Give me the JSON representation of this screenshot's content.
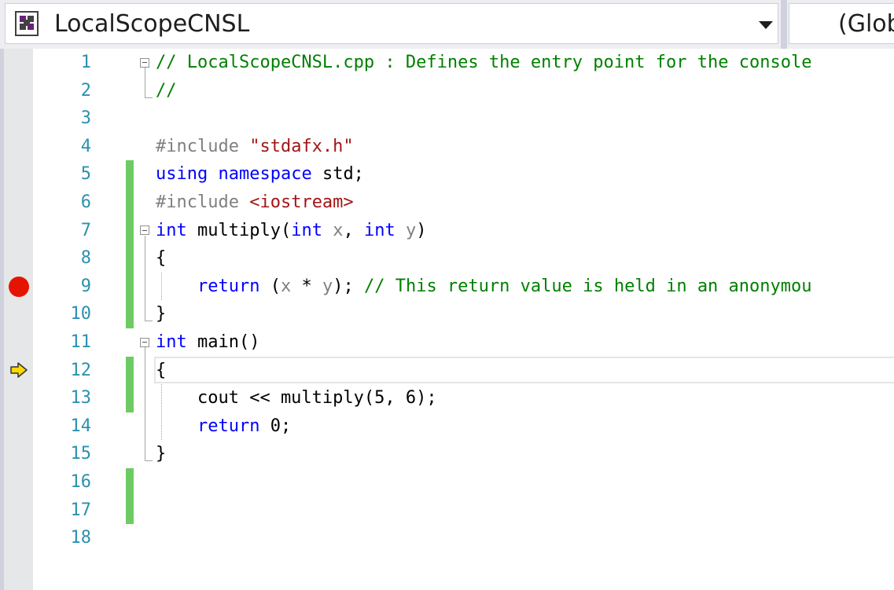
{
  "navbar": {
    "project_name": "LocalScopeCNSL",
    "scope_name": "(Global Scope)"
  },
  "icons": {
    "project": "cpp-project-icon",
    "dropdown": "chevron-down-icon",
    "breakpoint": "breakpoint-icon",
    "instruction_pointer": "instruction-pointer-arrow-icon"
  },
  "colors": {
    "keyword": "#0000ff",
    "comment": "#008000",
    "preprocessor": "#808080",
    "string": "#a31515",
    "line_number": "#2b91af",
    "change_bar": "#6ecb63",
    "breakpoint": "#e51400"
  },
  "editor": {
    "breakpoint_line": 9,
    "current_line": 12,
    "lines": [
      {
        "n": "1",
        "changed": false,
        "tokens": [
          {
            "t": "// LocalScopeCNSL.cpp : Defines the entry point for the console",
            "c": "cm"
          }
        ]
      },
      {
        "n": "2",
        "changed": false,
        "tokens": [
          {
            "t": "//",
            "c": "cm"
          }
        ]
      },
      {
        "n": "3",
        "changed": false,
        "tokens": []
      },
      {
        "n": "4",
        "changed": false,
        "tokens": [
          {
            "t": "#include ",
            "c": "pp"
          },
          {
            "t": "\"stdafx.h\"",
            "c": "st"
          }
        ]
      },
      {
        "n": "5",
        "changed": true,
        "tokens": [
          {
            "t": "using",
            "c": "kw"
          },
          {
            "t": " ",
            "c": ""
          },
          {
            "t": "namespace",
            "c": "kw"
          },
          {
            "t": " std;",
            "c": ""
          }
        ]
      },
      {
        "n": "6",
        "changed": true,
        "tokens": [
          {
            "t": "#include ",
            "c": "pp"
          },
          {
            "t": "<iostream>",
            "c": "st"
          }
        ]
      },
      {
        "n": "7",
        "changed": true,
        "tokens": [
          {
            "t": "int",
            "c": "kw"
          },
          {
            "t": " multiply(",
            "c": ""
          },
          {
            "t": "int",
            "c": "kw"
          },
          {
            "t": " ",
            "c": ""
          },
          {
            "t": "x",
            "c": "pa"
          },
          {
            "t": ", ",
            "c": ""
          },
          {
            "t": "int",
            "c": "kw"
          },
          {
            "t": " ",
            "c": ""
          },
          {
            "t": "y",
            "c": "pa"
          },
          {
            "t": ")",
            "c": ""
          }
        ]
      },
      {
        "n": "8",
        "changed": true,
        "tokens": [
          {
            "t": "{",
            "c": ""
          }
        ]
      },
      {
        "n": "9",
        "changed": true,
        "tokens": [
          {
            "t": "    ",
            "c": ""
          },
          {
            "t": "return",
            "c": "kw"
          },
          {
            "t": " (",
            "c": ""
          },
          {
            "t": "x",
            "c": "pa"
          },
          {
            "t": " * ",
            "c": ""
          },
          {
            "t": "y",
            "c": "pa"
          },
          {
            "t": "); ",
            "c": ""
          },
          {
            "t": "// This return value is held in an anonymou",
            "c": "cm"
          }
        ]
      },
      {
        "n": "10",
        "changed": true,
        "tokens": [
          {
            "t": "}",
            "c": ""
          }
        ]
      },
      {
        "n": "11",
        "changed": false,
        "tokens": [
          {
            "t": "int",
            "c": "kw"
          },
          {
            "t": " main()",
            "c": ""
          }
        ]
      },
      {
        "n": "12",
        "changed": true,
        "tokens": [
          {
            "t": "{",
            "c": ""
          }
        ]
      },
      {
        "n": "13",
        "changed": true,
        "tokens": [
          {
            "t": "    cout << multiply(5, 6);",
            "c": ""
          }
        ]
      },
      {
        "n": "14",
        "changed": false,
        "tokens": [
          {
            "t": "    ",
            "c": ""
          },
          {
            "t": "return",
            "c": "kw"
          },
          {
            "t": " 0;",
            "c": ""
          }
        ]
      },
      {
        "n": "15",
        "changed": false,
        "tokens": [
          {
            "t": "}",
            "c": ""
          }
        ]
      },
      {
        "n": "16",
        "changed": true,
        "tokens": []
      },
      {
        "n": "17",
        "changed": true,
        "tokens": []
      },
      {
        "n": "18",
        "changed": false,
        "tokens": []
      }
    ]
  }
}
